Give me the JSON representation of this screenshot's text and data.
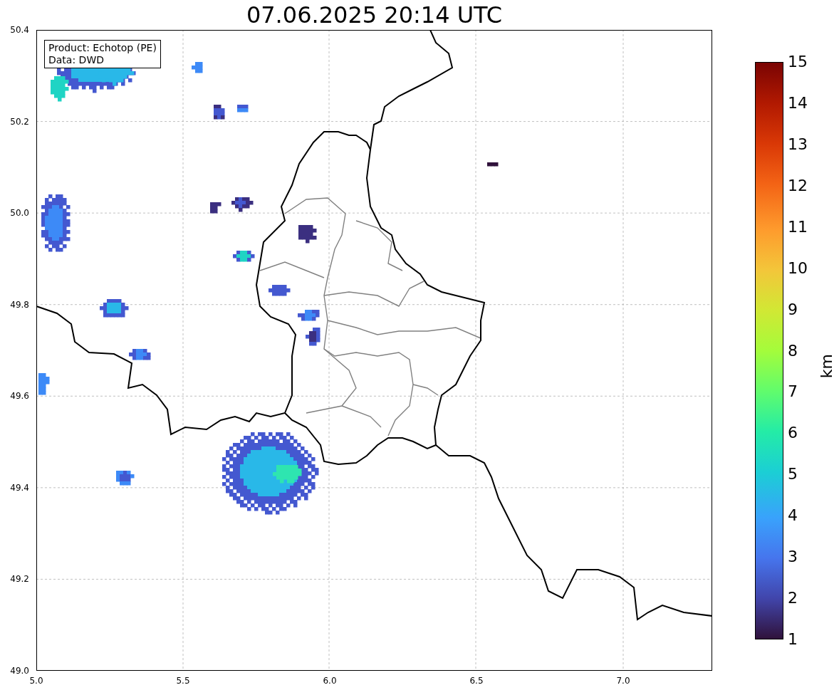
{
  "title": "07.06.2025 20:14 UTC",
  "info_box": [
    "Product: Echotop (PE)",
    "Data: DWD"
  ],
  "x_ticks": [
    "5.0",
    "5.5",
    "6.0",
    "6.5",
    "7.0"
  ],
  "y_ticks": [
    "50.4",
    "50.2",
    "50.0",
    "49.8",
    "49.6",
    "49.4",
    "49.2",
    "49.0"
  ],
  "colorbar": {
    "label": "km",
    "ticks": [
      "15",
      "14",
      "13",
      "12",
      "11",
      "10",
      "9",
      "8",
      "7",
      "6",
      "5",
      "4",
      "3",
      "2",
      "1"
    ]
  }
}
